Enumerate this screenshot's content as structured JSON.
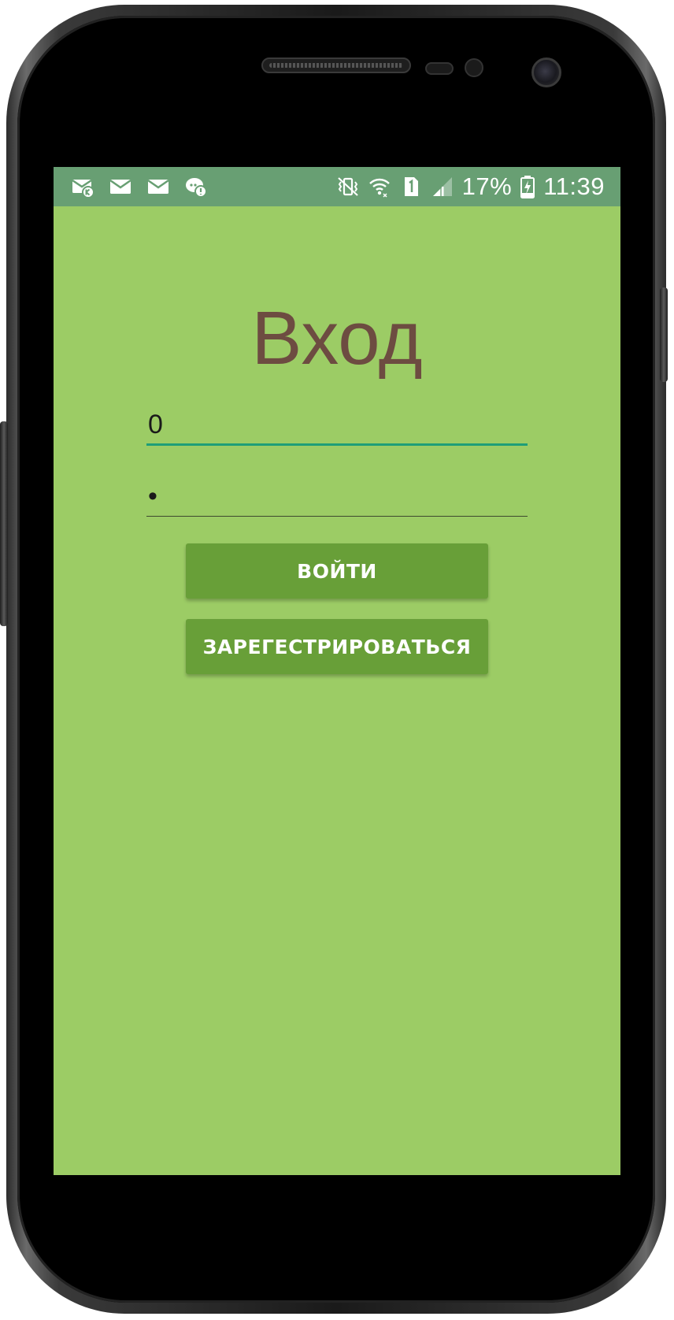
{
  "status_bar": {
    "notifications": [
      "mail-k-icon",
      "mail-icon",
      "mail-icon",
      "chat-alert-icon"
    ],
    "system_icons": [
      "vibrate-icon",
      "wifi-icon",
      "sim-1-icon",
      "signal-icon"
    ],
    "battery_percent": "17%",
    "time": "11:39"
  },
  "login": {
    "title": "Вход",
    "login_field": {
      "value": "0",
      "placeholder": ""
    },
    "password_field": {
      "value": "•",
      "placeholder": ""
    },
    "login_button": "ВОЙТИ",
    "register_button": "ЗАРЕГЕСТРИРОВАТЬСЯ"
  },
  "colors": {
    "screen_background": "#9ccc65",
    "status_bar": "#689f73",
    "title_text": "#6d4c41",
    "button": "#689f38",
    "field_focus_underline": "#1e9e78"
  }
}
